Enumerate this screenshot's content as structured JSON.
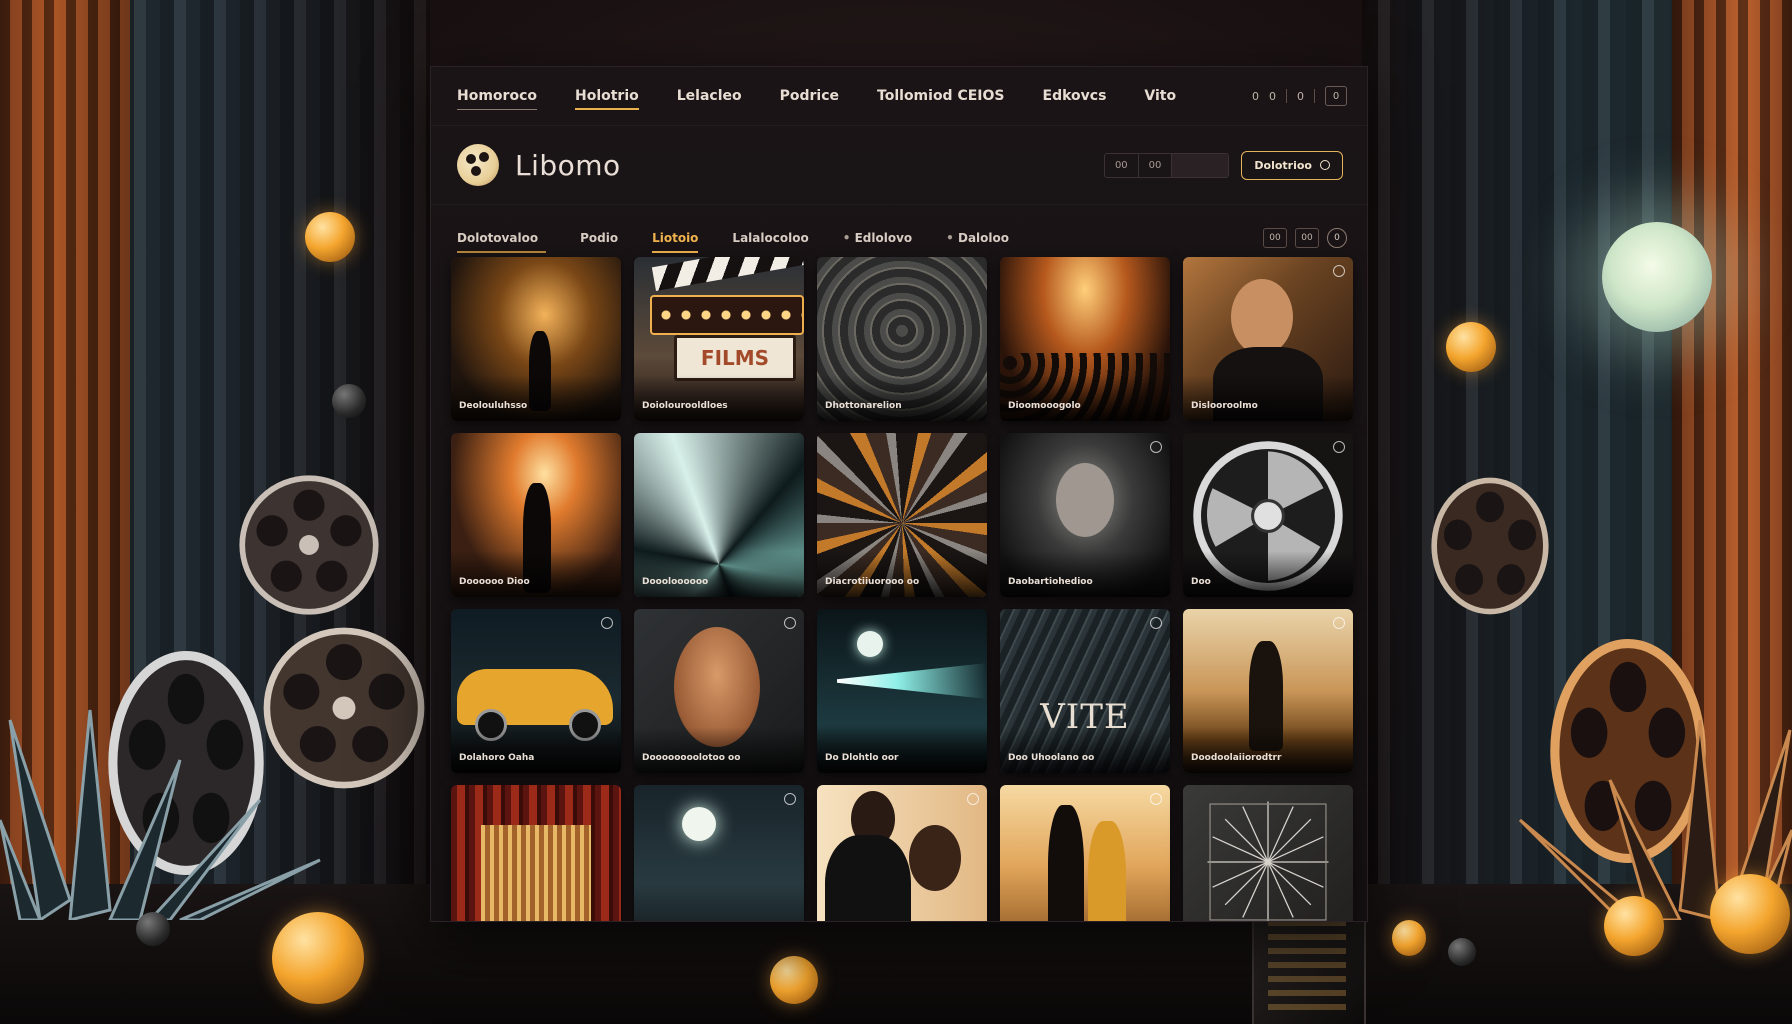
{
  "topnav": {
    "links": [
      "Homoroco",
      "Holotrio",
      "Lelacleo",
      "Podrice",
      "Tollomiod CEIOS",
      "Edkovcs",
      "Vito"
    ],
    "active_index": 1,
    "utils": [
      "0",
      "0",
      "0",
      "0"
    ]
  },
  "brand": {
    "name": "Libomo",
    "segments": [
      "00",
      "00",
      ""
    ],
    "cta_label": "Dolotrioo"
  },
  "tabs": {
    "items": [
      "Dolotovaloo",
      "Podio",
      "Liotoio",
      "Lalalocoloo",
      "Edlolovo",
      "Daloloo"
    ],
    "active_index": 2,
    "tools": [
      "00",
      "00",
      "0"
    ]
  },
  "cards": [
    {
      "caption": "Deolouluhsso",
      "theme": "city-gold"
    },
    {
      "caption": "Doiolourooldloes",
      "theme": "marquee",
      "overlay": "FILMS",
      "sign": "DODOOOO"
    },
    {
      "caption": "Dhottonarelion",
      "theme": "abstract-gray"
    },
    {
      "caption": "Dioomooogolo",
      "theme": "crowd-night"
    },
    {
      "caption": "Dislooroolmo",
      "theme": "portrait-man"
    },
    {
      "caption": "Doooooo Dioo",
      "theme": "street-walk"
    },
    {
      "caption": "Doooloooooo",
      "theme": "light-rays"
    },
    {
      "caption": "Diacrotiiuorooo oo",
      "theme": "abstract-orange"
    },
    {
      "caption": "Daobartiohedioo",
      "theme": "face-dark"
    },
    {
      "caption": "Doo",
      "theme": "film-reel"
    },
    {
      "caption": "Dolahoro Oaha",
      "theme": "yellow-car"
    },
    {
      "caption": "Doooooooolotoo oo",
      "theme": "woman-portrait"
    },
    {
      "caption": "Do Dlohtlo oor",
      "theme": "spotlight-sea"
    },
    {
      "caption": "Doo Uhoolano oo",
      "theme": "vite",
      "overlay": "VITE"
    },
    {
      "caption": "Doodoolaiiorodtrr",
      "theme": "desert-man"
    },
    {
      "caption": "",
      "theme": "curtain"
    },
    {
      "caption": "",
      "theme": "moon-night"
    },
    {
      "caption": "",
      "theme": "couple-kiss"
    },
    {
      "caption": "",
      "theme": "couple-sunset"
    },
    {
      "caption": "",
      "theme": "starburst"
    }
  ]
}
